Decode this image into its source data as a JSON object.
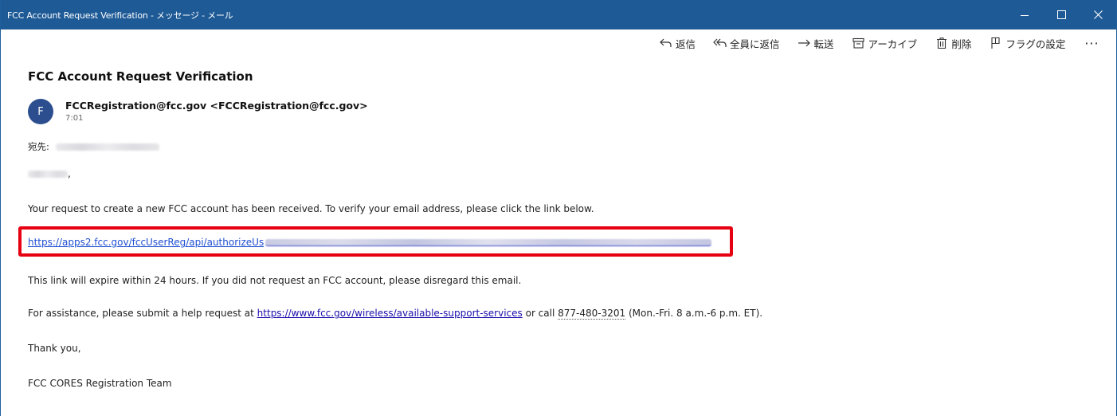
{
  "window": {
    "title": "FCC Account Request Verification - メッセージ - メール"
  },
  "toolbar": {
    "reply": "返信",
    "reply_all": "全員に返信",
    "forward": "転送",
    "archive": "アーカイブ",
    "delete": "削除",
    "flag": "フラグの設定",
    "more": "···"
  },
  "message": {
    "subject": "FCC Account Request Verification",
    "avatar_initial": "F",
    "sender": "FCCRegistration@fcc.gov <FCCRegistration@fcc.gov>",
    "time": "7:01",
    "to_label": "宛先:",
    "greeting_suffix": ",",
    "line1": "Your request to create a new FCC account has been received. To verify your email address, please click the link below.",
    "link_visible": "https://apps2.fcc.gov/fccUserReg/api/authorizeUs",
    "line3": "This link will expire within 24 hours.  If you did not request an FCC account, please disregard this email.",
    "line4_prefix": "For assistance, please submit a help request at ",
    "line4_link": "https://www.fcc.gov/wireless/available-support-services",
    "line4_mid": " or call ",
    "line4_phone": "877-480-3201",
    "line4_suffix": " (Mon.-Fri. 8 a.m.-6 p.m. ET).",
    "thanks": "Thank you,",
    "signature": "FCC CORES Registration Team"
  },
  "colors": {
    "titlebar": "#1e5a96",
    "avatar": "#2c4e8f",
    "highlight": "#e60012",
    "link": "#1a0dab"
  }
}
